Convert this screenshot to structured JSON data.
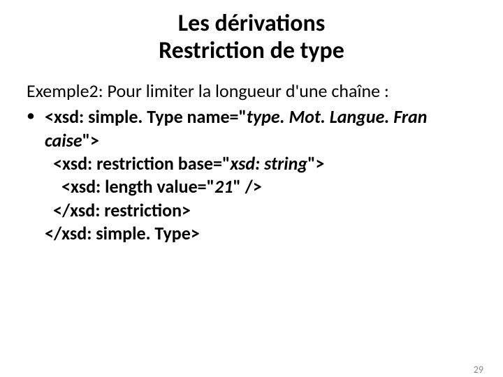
{
  "title_line1": "Les dérivations",
  "title_line2": "Restriction de type",
  "intro": "Exemple2: Pour limiter la longueur d'une chaîne :",
  "bullet": "•",
  "code": {
    "l1a": "<xsd: simple. Type name=\"",
    "l1b": "type. Mot. Langue. Fran",
    "l2a": "caise",
    "l2b": "\">",
    "l3a": "<xsd: restriction base=\"",
    "l3b": "xsd: string",
    "l3c": "\">",
    "l4a": "<xsd: length value=\"",
    "l4b": "21",
    "l4c": "\" />",
    "l5": "</xsd: restriction>",
    "l6": "</xsd: simple. Type>"
  },
  "page_number": "29"
}
